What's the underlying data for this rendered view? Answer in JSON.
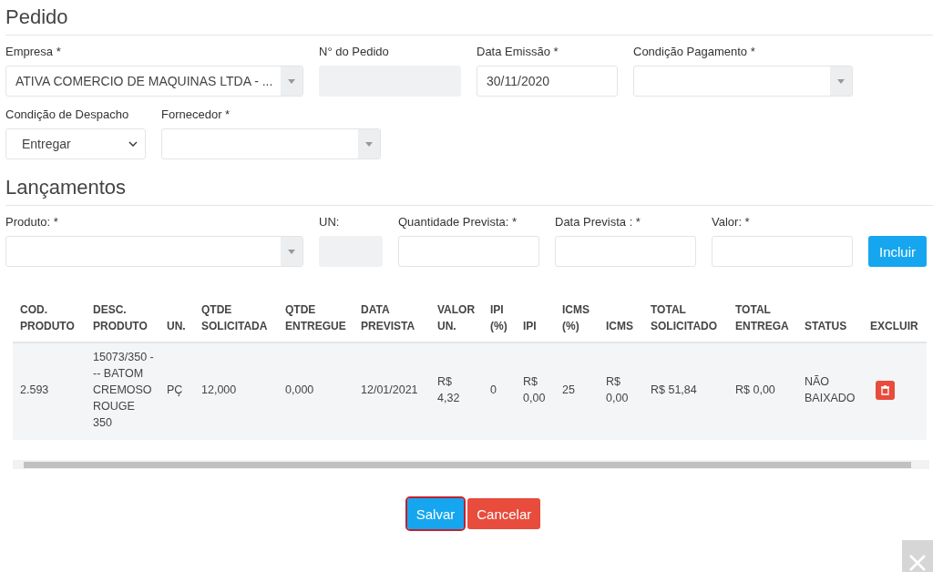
{
  "sections": [
    {
      "title": "Pedido",
      "fields": [
        {
          "label": "Empresa *",
          "kind": "select",
          "value": "ATIVA COMERCIO DE MAQUINAS LTDA - ..."
        },
        {
          "label": "N° do Pedido",
          "kind": "readonly"
        },
        {
          "label": "Data Emissão *",
          "kind": "input",
          "value": "30/11/2020"
        },
        {
          "label": "Condição Pagamento *",
          "kind": "select"
        },
        {
          "label": "Condição de Despacho",
          "kind": "dropdown",
          "value": "Entregar"
        },
        {
          "label": "Fornecedor *",
          "kind": "select"
        }
      ]
    },
    {
      "title": "Lançamentos",
      "fields": [
        {
          "label": "Produto: *",
          "kind": "select"
        },
        {
          "label": "UN:",
          "kind": "readonly"
        },
        {
          "label": "Quantidade Prevista: *",
          "kind": "input"
        },
        {
          "label": "Data Prevista : *",
          "kind": "input"
        },
        {
          "label": "Valor: *",
          "kind": "input"
        },
        {
          "label": "Incluir",
          "kind": "button"
        }
      ]
    }
  ],
  "table": {
    "columns": [
      "COD. PRODUTO",
      "DESC. PRODUTO",
      "UN.",
      "QTDE SOLICITADA",
      "QTDE ENTREGUE",
      "DATA PREVISTA",
      "VALOR UN.",
      "IPI (%)",
      "IPI",
      "ICMS (%)",
      "ICMS",
      "TOTAL SOLICITADO",
      "TOTAL ENTREGA",
      "STATUS",
      "EXCLUIR"
    ],
    "rows": [
      {
        "cells": [
          "2.593",
          "15073/350 --- BATOM CREMOSO ROUGE 350",
          "PÇ",
          "12,000",
          "0,000",
          "12/01/2021",
          "R$ 4,32",
          "0",
          "R$ 0,00",
          "25",
          "R$ 0,00",
          "R$ 51,84",
          "R$ 0,00",
          "NÃO BAIXADO"
        ]
      }
    ]
  },
  "buttons": [
    {
      "label": "Salvar",
      "kind": "primary",
      "focused": true
    },
    {
      "label": "Cancelar",
      "kind": "danger",
      "focused": false
    }
  ]
}
